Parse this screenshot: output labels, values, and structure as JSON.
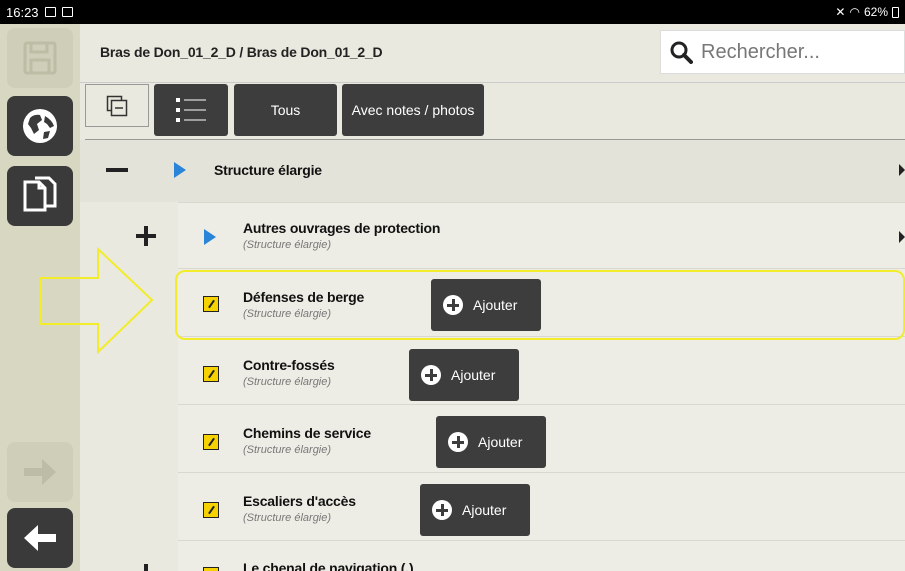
{
  "status_bar": {
    "time": "16:23",
    "battery": "62%"
  },
  "header": {
    "breadcrumb": "Bras de Don_01_2_D / Bras de Don_01_2_D",
    "search_placeholder": "Rechercher..."
  },
  "toolbar": {
    "all_label": "Tous",
    "notes_label": "Avec notes / photos"
  },
  "tree": {
    "section": {
      "title": "Structure élargie",
      "toggle": "−"
    },
    "group": {
      "title": "Autres ouvrages de protection",
      "subtitle": "(Structure élargie)",
      "toggle": "+"
    },
    "items": [
      {
        "title": "Défenses de berge",
        "subtitle": "(Structure élargie)",
        "action": "Ajouter"
      },
      {
        "title": "Contre-fossés",
        "subtitle": "(Structure élargie)",
        "action": "Ajouter"
      },
      {
        "title": "Chemins de service",
        "subtitle": "(Structure élargie)",
        "action": "Ajouter"
      },
      {
        "title": "Escaliers d'accès",
        "subtitle": "(Structure élargie)",
        "action": "Ajouter"
      }
    ],
    "partial": {
      "title": "Le chenal de navigation (.)"
    }
  },
  "colors": {
    "accent_highlight": "#f3ec2a",
    "button_dark": "#3d3d3d",
    "expand_arrow": "#2a84d8",
    "edit_icon": "#f5d200"
  }
}
